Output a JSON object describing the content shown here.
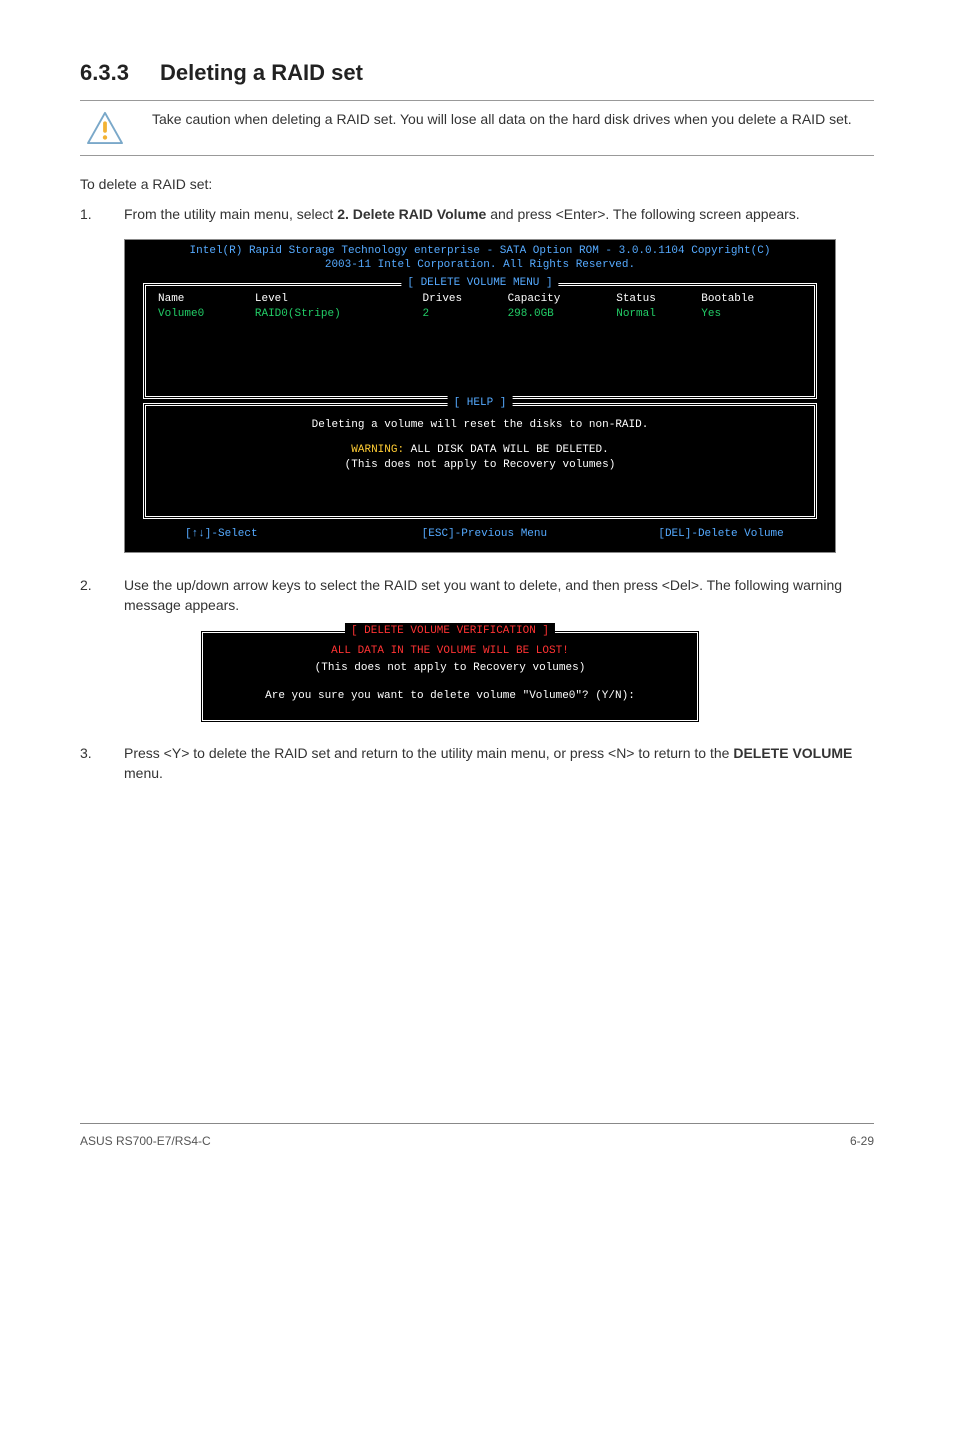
{
  "heading": {
    "number": "6.3.3",
    "title": "Deleting a RAID set"
  },
  "caution": "Take caution when deleting a RAID set. You will lose all data on the hard disk drives when you delete a RAID set.",
  "intro": "To delete a RAID set:",
  "steps": {
    "s1": {
      "num": "1.",
      "pre": "From the utility main menu, select ",
      "bold": "2. Delete RAID Volume",
      "post": " and press <Enter>. The following screen appears."
    },
    "s2": {
      "num": "2.",
      "text": "Use the up/down arrow keys to select the RAID set you want to delete, and then press <Del>. The following warning message appears."
    },
    "s3": {
      "num": "3.",
      "pre": "Press <Y> to delete the RAID set and return to the utility main menu, or press <N> to return to the ",
      "bold": "DELETE VOLUME",
      "post": " menu."
    }
  },
  "bios": {
    "title1": "Intel(R) Rapid Storage Technology enterprise - SATA Option ROM - 3.0.0.1104 Copyright(C)",
    "title2": "2003-11 Intel Corporation.  All Rights Reserved.",
    "panel1_label": "[ DELETE VOLUME MENU ]",
    "headers": {
      "c0": "Name",
      "c1": "Level",
      "c2": "Drives",
      "c3": "Capacity",
      "c4": "Status",
      "c5": "Bootable"
    },
    "row": {
      "c0": "Volume0",
      "c1": "RAID0(Stripe)",
      "c2": "2",
      "c3": "298.0GB",
      "c4": "Normal",
      "c5": "Yes"
    },
    "panel2_label": "[ HELP ]",
    "help_line1": "Deleting a volume will reset the disks to non-RAID.",
    "help_warn_prefix": "WARNING:",
    "help_warn_rest": " ALL DISK DATA WILL BE DELETED.",
    "help_line3": "(This does not apply to Recovery volumes)",
    "footer": {
      "a": "[↑↓]-Select",
      "b": "[ESC]-Previous Menu",
      "c": "[DEL]-Delete Volume"
    }
  },
  "confirm": {
    "label": "[ DELETE VOLUME VERIFICATION ]",
    "line1": "ALL DATA IN THE VOLUME WILL BE LOST!",
    "line2": "(This does not apply to Recovery volumes)",
    "line3": "Are you sure you want to delete volume \"Volume0\"? (Y/N):"
  },
  "footer": {
    "left": "ASUS RS700-E7/RS4-C",
    "right": "6-29"
  }
}
